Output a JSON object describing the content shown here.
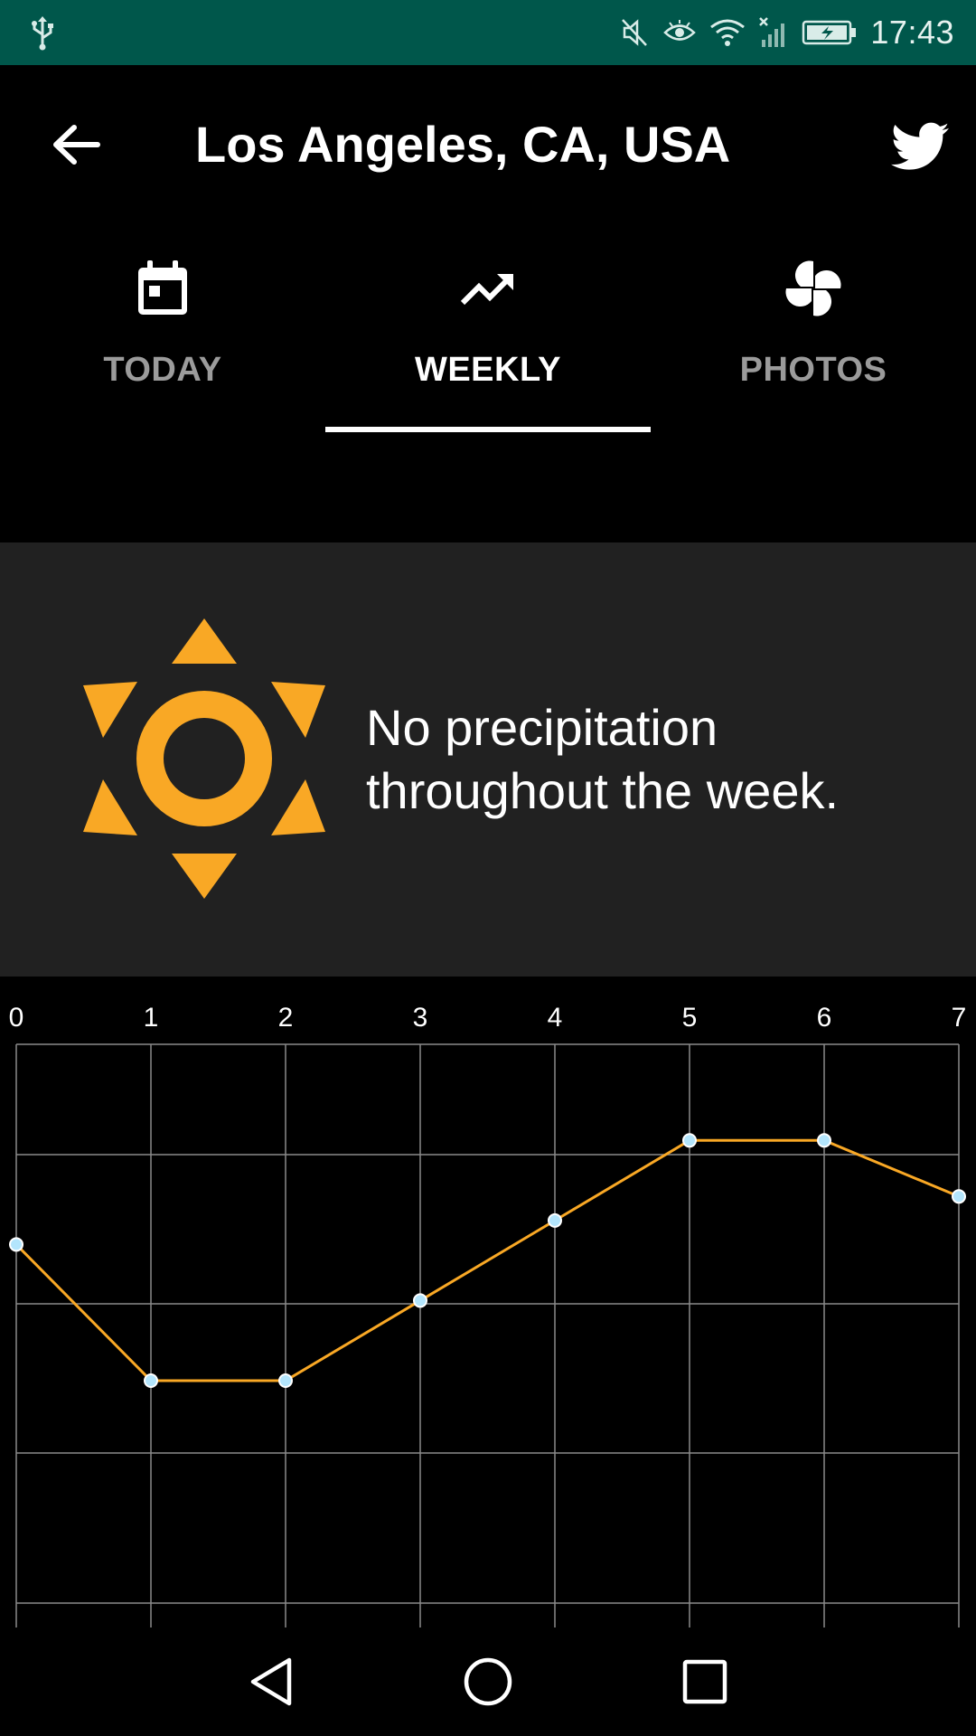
{
  "status_bar": {
    "time": "17:43",
    "icons": [
      "usb-icon",
      "mute-icon",
      "eye-icon",
      "wifi-icon",
      "signal-icon",
      "battery-charging-icon"
    ]
  },
  "app_bar": {
    "title": "Los Angeles, CA, USA",
    "back_icon": "arrow-back-icon",
    "share_icon": "twitter-icon"
  },
  "tabs": [
    {
      "label": "TODAY",
      "icon": "calendar-icon",
      "active": false
    },
    {
      "label": "WEEKLY",
      "icon": "trending-up-icon",
      "active": true
    },
    {
      "label": "PHOTOS",
      "icon": "photos-pinwheel-icon",
      "active": false
    }
  ],
  "summary": {
    "icon": "sun-icon",
    "text_line1": "No precipitation",
    "text_line2": "throughout the week.",
    "icon_color": "#F9A825"
  },
  "chart_data": {
    "type": "line",
    "x": [
      0,
      1,
      2,
      3,
      4,
      5,
      6,
      7
    ],
    "x_tick_labels": [
      "0",
      "1",
      "2",
      "3",
      "4",
      "5",
      "6",
      "7"
    ],
    "series": [
      {
        "values": [
          0.65,
          0.48,
          0.48,
          0.58,
          0.68,
          0.78,
          0.78,
          0.71
        ]
      }
    ],
    "ylim": [
      0.2,
      0.9
    ],
    "grid": true,
    "line_color": "#F9A825",
    "point_color": "#B3E5FC"
  },
  "nav_bar": {
    "icons": [
      "back-triangle-icon",
      "home-circle-icon",
      "recents-square-icon"
    ]
  }
}
